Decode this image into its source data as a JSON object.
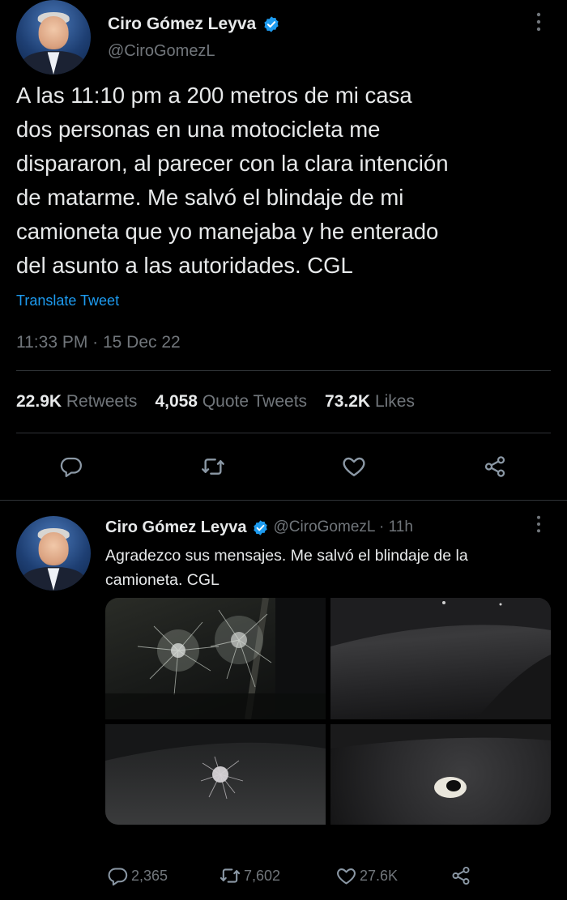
{
  "main_tweet": {
    "author_name": "Ciro Gómez Leyva",
    "handle": "@CiroGomezL",
    "lines": [
      "A las 11:10 pm a 200 metros de mi casa",
      "dos personas en una motocicleta me",
      "dispararon, al parecer con la clara intención",
      "de matarme. Me salvó el blindaje de mi",
      "camioneta que yo manejaba y he enterado",
      "del asunto a las autoridades. CGL"
    ],
    "translate_label": "Translate Tweet",
    "timestamp": "11:33 PM · 15 Dec 22",
    "stats": {
      "retweets_count": "22.9K",
      "retweets_label": "Retweets",
      "quotes_count": "4,058",
      "quotes_label": "Quote Tweets",
      "likes_count": "73.2K",
      "likes_label": "Likes"
    }
  },
  "reply_tweet": {
    "author_name": "Ciro Gómez Leyva",
    "handle_time": "@CiroGomezL · 11h",
    "text_lines": [
      "Agradezco sus mensajes. Me salvó el blindaje de la",
      "camioneta. CGL"
    ],
    "actions": {
      "replies": "2,365",
      "retweets": "7,602",
      "likes": "27.6K"
    }
  },
  "icons": [
    "more-vertical-icon",
    "verified-badge-icon",
    "reply-icon",
    "retweet-icon",
    "like-icon",
    "share-icon"
  ],
  "colors": {
    "background": "#000000",
    "text": "#e7e9ea",
    "muted": "#71767b",
    "link": "#1d9bf0",
    "divider": "#2f3336"
  }
}
